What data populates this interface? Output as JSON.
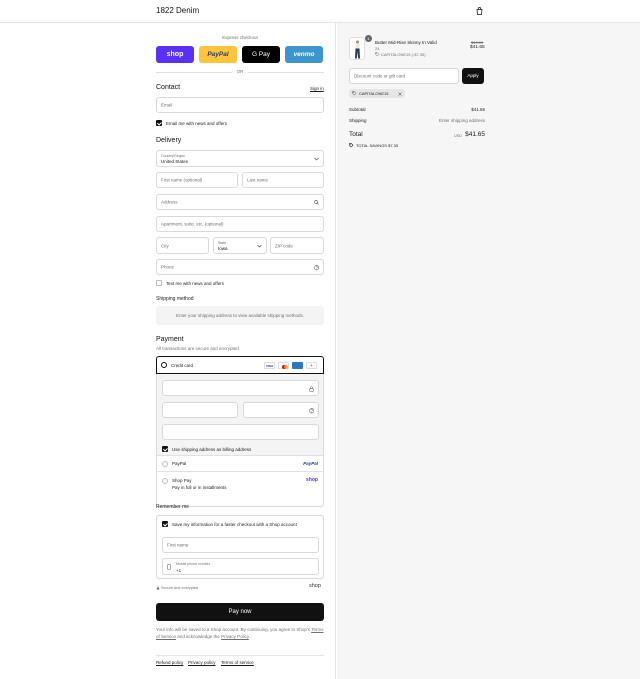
{
  "header": {
    "store_name": "1822 Denim",
    "cart_icon": "shopping-bag-icon"
  },
  "express": {
    "label": "Express checkout",
    "buttons": [
      {
        "label": "shop",
        "color": "#5a31f4"
      },
      {
        "label": "PayPal",
        "color": "#ffc439"
      },
      {
        "label": "G Pay",
        "color": "#000000"
      },
      {
        "label": "venmo",
        "color": "#3d95ce"
      }
    ],
    "or": "OR"
  },
  "contact": {
    "title": "Contact",
    "sign_in": "Sign in",
    "email_placeholder": "Email",
    "news_label": "Email me with news and offers"
  },
  "delivery": {
    "title": "Delivery",
    "country_label": "Country/Region",
    "country_value": "United States",
    "first_name": "First name (optional)",
    "last_name": "Last name",
    "address": "Address",
    "apartment": "Apartment, suite, etc. (optional)",
    "city": "City",
    "state_label": "State",
    "state_value": "Iowa",
    "zip": "ZIP code",
    "phone": "Phone",
    "text_news": "Text me with news and offers"
  },
  "shipping": {
    "title": "Shipping method",
    "info": "Enter your shipping address to view available shipping methods."
  },
  "payment": {
    "title": "Payment",
    "subtitle": "All transactions are secure and encrypted.",
    "credit_card": "Credit card",
    "card_more": "+",
    "billing_label": "Use shipping address as billing address",
    "paypal": "PayPal",
    "paypal_logo": "PayPal",
    "shop_pay": "Shop Pay",
    "shop_pay_sub": "Pay in full or in installments",
    "shop_logo": "shop"
  },
  "remember": {
    "title": "Remember me",
    "save_label": "Save my information for a faster checkout with a Shop account",
    "first_name": "First name",
    "mobile_label": "Mobile phone number",
    "mobile_value": "+1",
    "secure": "Secure and encrypted",
    "shop_logo": "shop"
  },
  "pay_now": "Pay now",
  "legal": {
    "line1": "Your info will be saved to a Shop account. By continuing, you agree to Shop's",
    "terms": "Terms of Service",
    "and": "and acknowledge the",
    "privacy": "Privacy Policy",
    "end": "."
  },
  "footer_links": [
    "Refund policy",
    "Privacy policy",
    "Terms of service"
  ],
  "summary": {
    "product": {
      "qty": "1",
      "name": "Butter Mid-Rise Skinny In Valid",
      "variant": "24",
      "discount": "CAPITALONE15 (-$7.35)",
      "original_price": "$49.00",
      "price": "$41.65"
    },
    "discount_placeholder": "Discount code or gift card",
    "apply": "Apply",
    "applied_code": "CAPITALONE15",
    "subtotal_label": "Subtotal",
    "subtotal_value": "$41.65",
    "shipping_label": "Shipping",
    "shipping_value": "Enter shipping address",
    "total_label": "Total",
    "currency": "USD",
    "total_value": "$41.65",
    "savings": "TOTAL SAVINGS",
    "savings_value": "$7.35"
  }
}
